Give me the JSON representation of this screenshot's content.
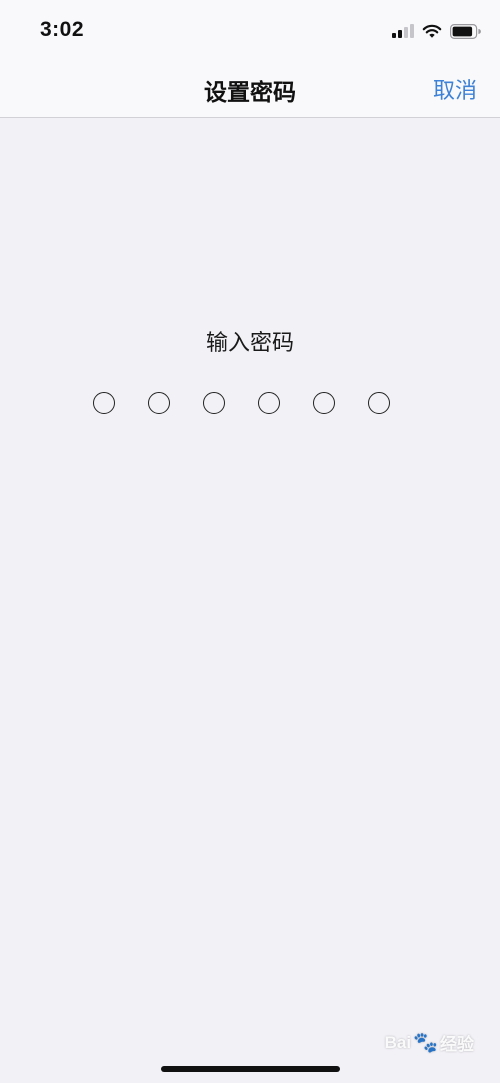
{
  "status_bar": {
    "time": "3:02",
    "icons": [
      "cellular-signal-icon",
      "wifi-icon",
      "battery-icon"
    ]
  },
  "nav": {
    "title": "设置密码",
    "cancel_label": "取消"
  },
  "passcode": {
    "prompt": "输入密码",
    "digits_total": 6,
    "digits_entered": 0
  },
  "watermark": {
    "brand_latin": "Bai",
    "brand_cn": "经验"
  },
  "colors": {
    "accent": "#3d82d6",
    "background": "#f2f1f6",
    "bar_background": "#f9f9fb"
  }
}
